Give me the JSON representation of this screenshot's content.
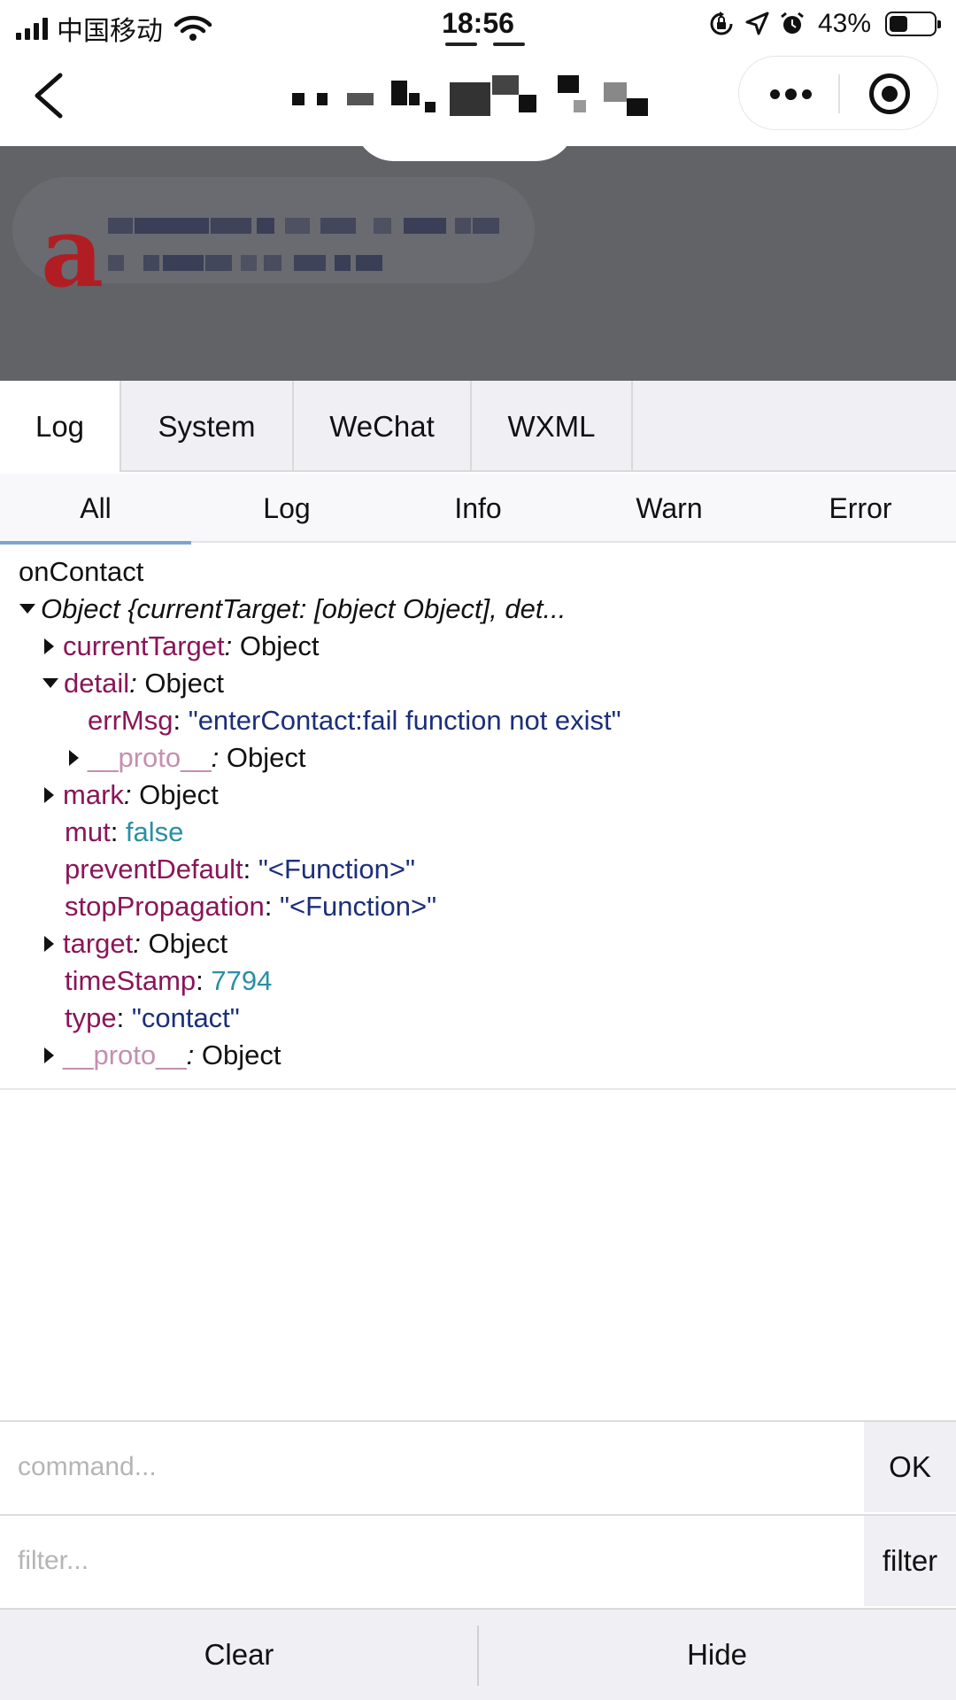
{
  "status_bar": {
    "carrier": "中国移动",
    "time": "18:56",
    "battery": "43%",
    "battery_level": 0.43
  },
  "top_tabs": [
    {
      "label": "Log",
      "active": true
    },
    {
      "label": "System",
      "active": false
    },
    {
      "label": "WeChat",
      "active": false
    },
    {
      "label": "WXML",
      "active": false
    }
  ],
  "level_tabs": [
    {
      "label": "All",
      "active": true
    },
    {
      "label": "Log",
      "active": false
    },
    {
      "label": "Info",
      "active": false
    },
    {
      "label": "Warn",
      "active": false
    },
    {
      "label": "Error",
      "active": false
    }
  ],
  "log": {
    "event_name": "onContact",
    "object_summary": "Object {currentTarget: [object Object], det...",
    "fields": {
      "currentTarget": {
        "key": "currentTarget",
        "sep": ": ",
        "value": "Object"
      },
      "detail": {
        "key": "detail",
        "sep": ": ",
        "value": "Object"
      },
      "errMsg": {
        "key": "errMsg",
        "sep": ": ",
        "value": "\"enterContact:fail function not exist\""
      },
      "detail_proto": {
        "key": "__proto__",
        "sep": ": ",
        "value": "Object"
      },
      "mark": {
        "key": "mark",
        "sep": ": ",
        "value": "Object"
      },
      "mut": {
        "key": "mut",
        "sep": ": ",
        "value": "false"
      },
      "preventDefault": {
        "key": "preventDefault",
        "sep": ": ",
        "value": "\"<Function>\""
      },
      "stopPropagation": {
        "key": "stopPropagation",
        "sep": ": ",
        "value": "\"<Function>\""
      },
      "target": {
        "key": "target",
        "sep": ": ",
        "value": "Object"
      },
      "timeStamp": {
        "key": "timeStamp",
        "sep": ": ",
        "value": "7794"
      },
      "type": {
        "key": "type",
        "sep": ": ",
        "value": "\"contact\""
      },
      "proto": {
        "key": "__proto__",
        "sep": ": ",
        "value": "Object"
      }
    }
  },
  "command": {
    "placeholder": "command...",
    "button": "OK"
  },
  "filter": {
    "placeholder": "filter...",
    "button": "filter"
  },
  "bottom": {
    "clear": "Clear",
    "hide": "Hide"
  }
}
